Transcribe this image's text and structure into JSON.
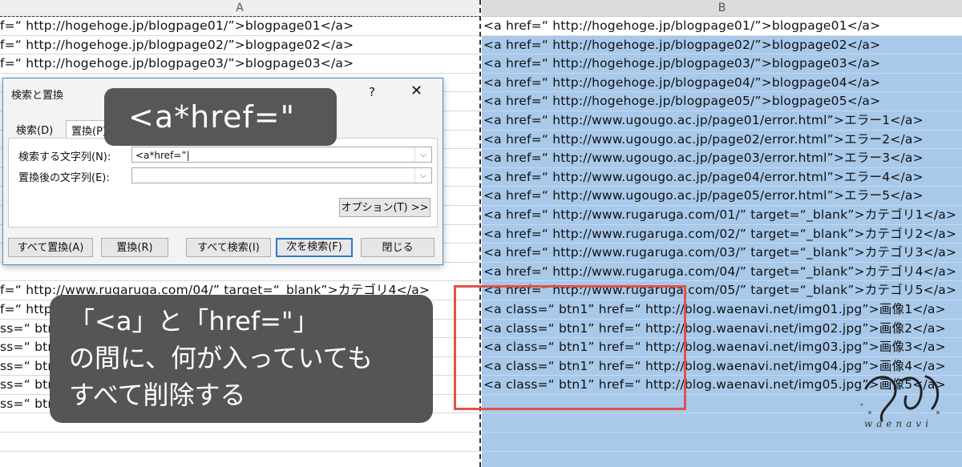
{
  "columns": {
    "a": "A",
    "b": "B"
  },
  "col_a_rows": [
    "f=“ http://hogehoge.jp/blogpage01/”>blogpage01</a>",
    "f=“ http://hogehoge.jp/blogpage02/”>blogpage02</a>",
    "f=“ http://hogehoge.jp/blogpage03/”>blogpage03</a>",
    "",
    "",
    "",
    "",
    "",
    "",
    "",
    "",
    "",
    "",
    "",
    "f=“ http://www.rugaruga.com/04/”  target=“_blank”>カテゴリ4</a>",
    "f=“ http://www.rugaruga.com/05/”  target=“_blank”>カテゴリ5</a>",
    "ss=“ btn1”  href=“ http://blog.waenavi.net/img01.jpg”>画像1</a>",
    "ss=“ btn1”  href=“ http://blog.waenavi.net/img02.jpg”>画像2</a>",
    "ss=“ btn1”  href=“ http://blog.waenavi.net/img03.jpg”>画像3</a>",
    "ss=“ btn1”  href=“ http://blog.waenavi.net/img04.jpg”>画像4</a>",
    "ss=“ btn1”  href=“ http://blog.waenavi.net/img05.jpg”>画像5</a>",
    "",
    "",
    "",
    ""
  ],
  "col_b_rows": [
    "<a href=“ http://hogehoge.jp/blogpage01/”>blogpage01</a>",
    "<a href=“ http://hogehoge.jp/blogpage02/”>blogpage02</a>",
    "<a href=“ http://hogehoge.jp/blogpage03/”>blogpage03</a>",
    "<a href=“ http://hogehoge.jp/blogpage04/”>blogpage04</a>",
    "<a href=“ http://hogehoge.jp/blogpage05/”>blogpage05</a>",
    "<a href=“ http://www.ugougo.ac.jp/page01/error.html”>エラー1</a>",
    "<a href=“ http://www.ugougo.ac.jp/page02/error.html”>エラー2</a>",
    "<a href=“ http://www.ugougo.ac.jp/page03/error.html”>エラー3</a>",
    "<a href=“ http://www.ugougo.ac.jp/page04/error.html”>エラー4</a>",
    "<a href=“ http://www.ugougo.ac.jp/page05/error.html”>エラー5</a>",
    "<a href=“ http://www.rugaruga.com/01/”  target=“_blank”>カテゴリ1</a>",
    "<a href=“ http://www.rugaruga.com/02/”  target=“_blank”>カテゴリ2</a>",
    "<a href=“ http://www.rugaruga.com/03/”  target=“_blank”>カテゴリ3</a>",
    "<a href=“ http://www.rugaruga.com/04/”  target=“_blank”>カテゴリ4</a>",
    "<a href=“ http://www.rugaruga.com/05/”  target=“_blank”>カテゴリ5</a>",
    "<a class=“ btn1”  href=“ http://blog.waenavi.net/img01.jpg”>画像1</a>",
    "<a class=“ btn1”  href=“ http://blog.waenavi.net/img02.jpg”>画像2</a>",
    "<a class=“ btn1”  href=“ http://blog.waenavi.net/img03.jpg”>画像3</a>",
    "<a class=“ btn1”  href=“ http://blog.waenavi.net/img04.jpg”>画像4</a>",
    "<a class=“ btn1”  href=“ http://blog.waenavi.net/img05.jpg”>画像5</a>",
    "",
    "",
    "",
    ""
  ],
  "dialog": {
    "title": "検索と置換",
    "help": "?",
    "close": "✕",
    "tab_search": "検索(D)",
    "tab_replace": "置換(P)",
    "find_label": "検索する文字列(N):",
    "find_value": "<a*href=”|",
    "replace_label": "置換後の文字列(E):",
    "replace_value": "",
    "options_button": "オプション(T) >>",
    "replace_all_button": "すべて置換(A)",
    "replace_button": "置換(R)",
    "find_all_button": "すべて検索(I)",
    "find_next_button": "次を検索(F)",
    "close_button": "閉じる"
  },
  "overlay": {
    "pattern": "<a*href=\"",
    "note_line1": "「<a」と「href=\"」",
    "note_line2": "の間に、何が入っていても",
    "note_line3": "すべて削除する"
  },
  "logo": {
    "text": "waenavi"
  },
  "colors": {
    "selection": "#a9c9ea",
    "highlight_box": "#e0524a",
    "bubble": "#555555",
    "dialog_accent": "#2a79c9"
  }
}
